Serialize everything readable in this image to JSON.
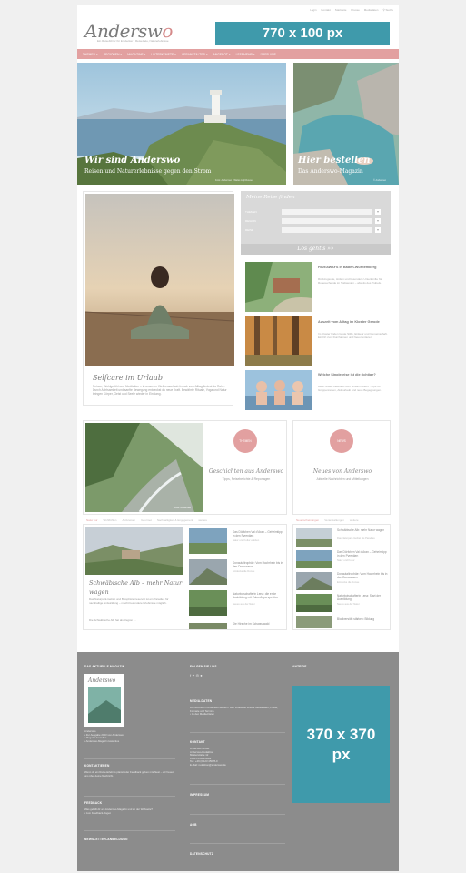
{
  "topnav": [
    "Login",
    "Kontakt",
    "Startseite",
    "Presse",
    "Mediadaten",
    "Suche"
  ],
  "logo": {
    "text": "Andersw",
    "accent": "o"
  },
  "tagline": "Ein Reiseführer für Entdecker · Reiseziele, Naturerlebnisse",
  "banner_top": "770 x 100 px",
  "mainnav": [
    "THEMEN ▾",
    "REGIONEN ▾",
    "MAGAZINE ▾",
    "UNTERKÜNFTE ▾",
    "VERANSTALTER ▾",
    "ANGEBOT ▾",
    "LESEMEHR ▾",
    "ÜBER UNS"
  ],
  "hero_left": {
    "title": "Wir sind Anderswo",
    "subtitle": "Reisen und Naturerlebnisse gegen den Strom",
    "credit": "Foto: Anderswo · Wales Lighthouse"
  },
  "hero_right": {
    "title": "Hier bestellen",
    "subtitle": "Das Anderswo-Magazin",
    "credit": "© Anderswo"
  },
  "main_article": {
    "title": "Selfcare im Urlaub",
    "text": "Reisen, Wohlgefühl und Meditation – in unserem Wellnessurlaub fernab vom Alltag findest du Ruhe. Durch Achtsamkeit und sanfte Bewegung entdeckst du neue Kraft. Bewährte Rituale, Yoga und Natur bringen Körper, Geist und Seele wieder in Einklang."
  },
  "search": {
    "title": "Meine Reise finden",
    "rows": [
      {
        "label": "THEMEN",
        "chev": "▾"
      },
      {
        "label": "REGION",
        "chev": "▾"
      },
      {
        "label": "REISE",
        "chev": "▾"
      }
    ],
    "button": "Los geht's »»"
  },
  "side_articles": [
    {
      "title": "HIDEAWAYS in Baden-Württemberg",
      "text": "Rückzugsorte, Hütten und besondere Unterkünfte für Ruhesuchende im Südwesten – abseits des Trubels."
    },
    {
      "title": "Auszeit vom Alltag im Kloster Gerode",
      "text": "Im Kloster finden Gäste Stille, Einkehr und Gemeinschaft. Ein Ort zum Durchatmen und Neuorientieren."
    },
    {
      "title": "Welche Singlereise ist die richtige?",
      "text": "Allein reisen bedeutet nicht einsam reisen. Tipps für Gruppenreisen, Aktivurlaub und neue Begegnungen."
    }
  ],
  "mid_left": {
    "badge": "THEMEN",
    "title": "Geschichten aus Anderswo",
    "subtitle": "Tipps, Reiseberichte & Reportagen",
    "credit": "Foto: Anderswo"
  },
  "mid_right": {
    "badge": "NEWS",
    "title": "Neues von Anderswo",
    "subtitle": "Aktuelle Nachrichten und Mitteilungen"
  },
  "tabs_left": [
    "Natur pur",
    "Wohlfühlen",
    "Aktivreisen",
    "Gourmet",
    "Nachhaltigkeit & Engagement",
    "weitere"
  ],
  "tabs_right": [
    "Neuerscheinungen",
    "Veranstaltungen",
    "weitere"
  ],
  "feature": {
    "title": "Schwäbische Alb – mehr Natur",
    "title2": "wagen",
    "text": "Das Naturpark-Gebiet und Biosphärenreservat ist ein Paradies für nachhaltige Entwicklung – macht besondere Erlebnisse möglich.",
    "more": "Die Schwäbische Alb hat als Region …"
  },
  "list_left": [
    {
      "title": "Das Dörfchen Val d’Aran – Geheimtipp in den Pyrenäen",
      "sub": "Natur und Kultur erleben"
    },
    {
      "title": "Donautaltrophäe: Vom Hochrhein bis in den Donauraum",
      "sub": "Entdecke die Donau"
    },
    {
      "title": "Naturbotschafterin Lena: die erste Ausbildung mit Zukunftsperspektive",
      "sub": "Neues aus der Natur"
    },
    {
      "title": "Die Hirsche im Schwarzwald",
      "sub": ""
    }
  ],
  "list_right": [
    {
      "title": "Schwäbische Alb: mehr Natur wagen",
      "sub": "Das Naturpark-Gebiet als Paradies"
    },
    {
      "title": "Das Dörfchen Val d’Aran – Geheimtipp in den Pyrenäen",
      "sub": "Natur und Kultur"
    },
    {
      "title": "Donautaltrophäe: Vom Hochrhein bis in den Donauraum",
      "sub": "Entdecke die Donau"
    },
    {
      "title": "Naturbotschafterin Lena: Start der Ausbildung",
      "sub": "Neues aus der Natur"
    },
    {
      "title": "Biodiversität stärken: Bildung",
      "sub": ""
    }
  ],
  "footer": {
    "col1": {
      "magazine_h": "DAS AKTUELLE MAGAZIN",
      "magazine_t": "Anderswo\n• Zur Ausgabe 2023 von Anderswo\n• Magazin bestellen\n• Anderswo-Magazin kostenlos",
      "contact_h": "KONTAKTIEREN",
      "contact_t": "Wenn du ein Reise-Erlebnis planst oder Feedback geben möchtest – wir freuen uns über deine Nachricht.",
      "feedback_h": "FEEDBACK",
      "feedback_t": "Was gefällt dir am Anderswo-Magazin und an der Webseite?\n• zum Feedback-Bogen",
      "newsletter_h": "NEWSLETTER-ANMELDUNG"
    },
    "col2": {
      "follow_h": "FOLGEN SIE UNS",
      "social": "f  ✦  ◎  ●",
      "media_h": "MEDIA-DATEN",
      "media_t": "Du möchtest in Anderswo werben? Hier findest du unsere Mediadaten, Preise, Formate und Termine.\n• zu den Media-Daten",
      "kontakt_h": "KONTAKT",
      "kontakt_t": "Anderswo GmbH\nAnderswo-Redaktion\nMusterstraße 12\n12345 Musterstadt\nTel.: +49 (0)123 45678-0\nE-Mail: redaktion@anderswo.de",
      "impressum_h": "IMPRESSUM",
      "agb_h": "AGB",
      "datenschutz_h": "DATENSCHUTZ"
    },
    "col3": {
      "anzeige_h": "ANZEIGE",
      "ad_text": "370 x 370 px"
    }
  }
}
